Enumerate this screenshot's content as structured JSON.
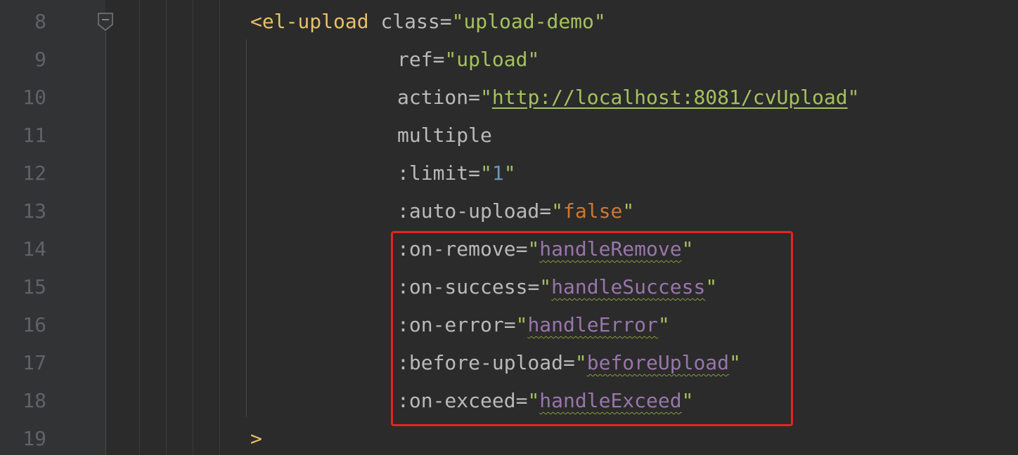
{
  "editor": {
    "line_numbers": [
      "8",
      "9",
      "10",
      "11",
      "12",
      "13",
      "14",
      "15",
      "16",
      "17",
      "18",
      "19"
    ],
    "lines": [
      {
        "open": "<el-upload",
        "attr": "class",
        "value": "upload-demo"
      },
      {
        "attr": "ref",
        "value": "upload"
      },
      {
        "attr": "action",
        "value": "http://localhost:8081/cvUpload"
      },
      {
        "attr": "multiple"
      },
      {
        "attr": ":limit",
        "value": "1"
      },
      {
        "attr": ":auto-upload",
        "value": "false"
      },
      {
        "attr": ":on-remove",
        "value": "handleRemove"
      },
      {
        "attr": ":on-success",
        "value": "handleSuccess"
      },
      {
        "attr": ":on-error",
        "value": "handleError"
      },
      {
        "attr": ":before-upload",
        "value": "beforeUpload"
      },
      {
        "attr": ":on-exceed",
        "value": "handleExceed"
      },
      {
        "close": ">"
      }
    ],
    "punct": {
      "eq": "=",
      "quote": "\""
    },
    "highlight": {
      "color": "#e8231f"
    },
    "colors": {
      "background": "#2b2b2b",
      "gutter": "#313335",
      "tag": "#e8bf6a",
      "attribute": "#bababa",
      "string": "#a5c25c",
      "number": "#6897bb",
      "keyword": "#cc7832",
      "function_ref": "#9876aa",
      "line_number": "#606366"
    }
  }
}
